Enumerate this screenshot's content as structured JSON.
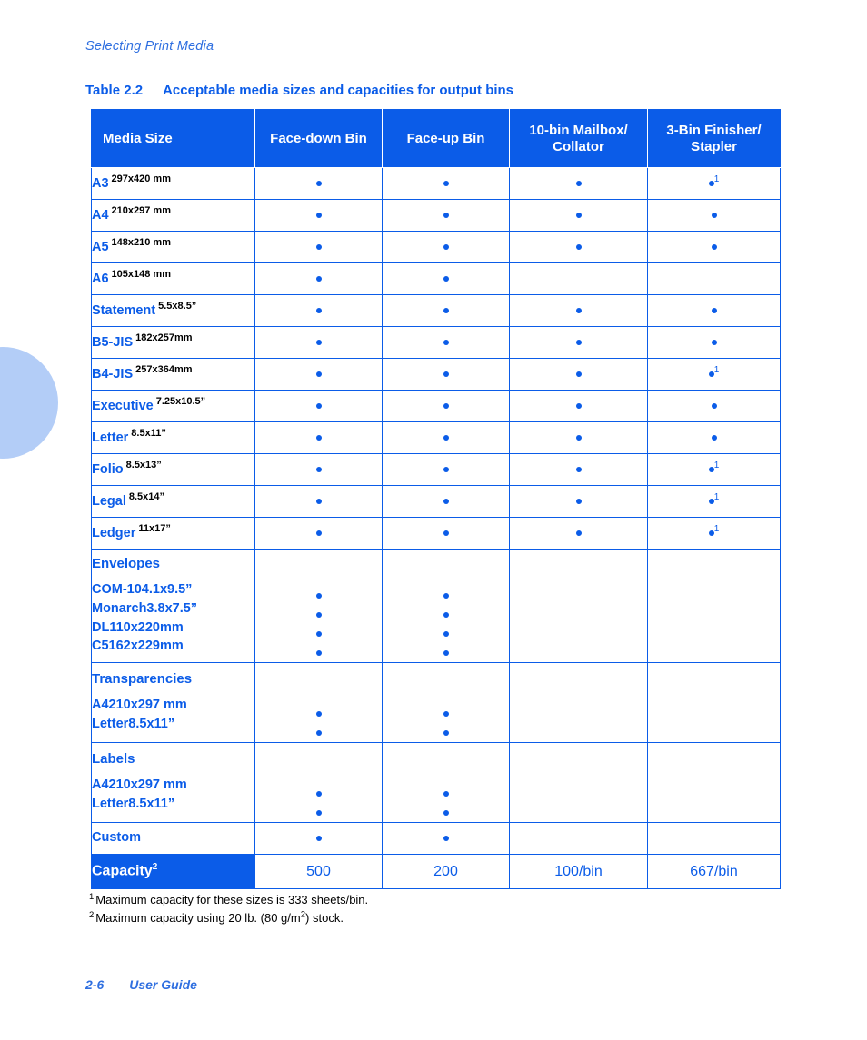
{
  "running_header": "Selecting Print Media",
  "table_caption": {
    "number": "Table 2.2",
    "title": "Acceptable media sizes and capacities for output bins"
  },
  "table": {
    "columns": [
      "Media Size",
      "Face-down Bin",
      "Face-up Bin",
      "10-bin Mailbox/\nCollator",
      "3-Bin Finisher/\nStapler"
    ],
    "column_headers": {
      "media_size": "Media Size",
      "face_down": "Face-down Bin",
      "face_up": "Face-up Bin",
      "mailbox_l1": "10-bin Mailbox/",
      "mailbox_l2": "Collator",
      "finisher_l1": "3-Bin Finisher/",
      "finisher_l2": "Stapler"
    },
    "rows": [
      {
        "name": "A3",
        "dim": "297x420 mm",
        "face_down": true,
        "face_up": true,
        "mailbox": true,
        "finisher": true,
        "finisher_note": "1"
      },
      {
        "name": "A4",
        "dim": "210x297 mm",
        "face_down": true,
        "face_up": true,
        "mailbox": true,
        "finisher": true,
        "finisher_note": ""
      },
      {
        "name": "A5",
        "dim": "148x210 mm",
        "face_down": true,
        "face_up": true,
        "mailbox": true,
        "finisher": true,
        "finisher_note": ""
      },
      {
        "name": "A6",
        "dim": "105x148 mm",
        "face_down": true,
        "face_up": true,
        "mailbox": false,
        "finisher": false,
        "finisher_note": ""
      },
      {
        "name": "Statement",
        "dim": "5.5x8.5”",
        "face_down": true,
        "face_up": true,
        "mailbox": true,
        "finisher": true,
        "finisher_note": ""
      },
      {
        "name": "B5-JIS",
        "dim": "182x257mm",
        "face_down": true,
        "face_up": true,
        "mailbox": true,
        "finisher": true,
        "finisher_note": ""
      },
      {
        "name": "B4-JIS",
        "dim": "257x364mm",
        "face_down": true,
        "face_up": true,
        "mailbox": true,
        "finisher": true,
        "finisher_note": "1"
      },
      {
        "name": "Executive",
        "dim": "7.25x10.5”",
        "face_down": true,
        "face_up": true,
        "mailbox": true,
        "finisher": true,
        "finisher_note": ""
      },
      {
        "name": "Letter",
        "dim": "8.5x11”",
        "face_down": true,
        "face_up": true,
        "mailbox": true,
        "finisher": true,
        "finisher_note": ""
      },
      {
        "name": "Folio",
        "dim": "8.5x13”",
        "face_down": true,
        "face_up": true,
        "mailbox": true,
        "finisher": true,
        "finisher_note": "1"
      },
      {
        "name": "Legal",
        "dim": "8.5x14”",
        "face_down": true,
        "face_up": true,
        "mailbox": true,
        "finisher": true,
        "finisher_note": "1"
      },
      {
        "name": "Ledger",
        "dim": "11x17”",
        "face_down": true,
        "face_up": true,
        "mailbox": true,
        "finisher": true,
        "finisher_note": "1"
      }
    ],
    "groups": [
      {
        "title": "Envelopes",
        "items": [
          {
            "name": "COM-10",
            "dim": "4.1x9.5”",
            "gap": true
          },
          {
            "name": "Monarch",
            "dim": "3.8x7.5”",
            "gap": true
          },
          {
            "name": "DL",
            "dim": "110x220mm",
            "gap": false
          },
          {
            "name": "C5",
            "dim": "162x229mm",
            "gap": false
          }
        ],
        "face_down": [
          true,
          true,
          true,
          true
        ],
        "face_up": [
          true,
          true,
          true,
          true
        ],
        "mailbox": [
          false,
          false,
          false,
          false
        ],
        "finisher": [
          false,
          false,
          false,
          false
        ]
      },
      {
        "title": "Transparencies",
        "items": [
          {
            "name": "A4",
            "dim": "210x297 mm",
            "gap": true
          },
          {
            "name": "Letter",
            "dim": "8.5x11”",
            "gap": true
          }
        ],
        "face_down": [
          true,
          true
        ],
        "face_up": [
          true,
          true
        ],
        "mailbox": [
          false,
          false
        ],
        "finisher": [
          false,
          false
        ]
      },
      {
        "title": "Labels",
        "items": [
          {
            "name": "A4",
            "dim": "210x297 mm",
            "gap": true
          },
          {
            "name": "Letter",
            "dim": "8.5x11”",
            "gap": true
          }
        ],
        "face_down": [
          true,
          true
        ],
        "face_up": [
          true,
          true
        ],
        "mailbox": [
          false,
          false
        ],
        "finisher": [
          false,
          false
        ]
      }
    ],
    "custom_row": {
      "name": "Custom",
      "dim": "",
      "face_down": true,
      "face_up": true,
      "mailbox": false,
      "finisher": false
    },
    "capacity_row": {
      "label": "Capacity",
      "label_note": "2",
      "face_down": "500",
      "face_up": "200",
      "mailbox": "100/bin",
      "finisher": "667/bin"
    }
  },
  "footnotes": [
    {
      "marker": "1",
      "text_before": "Maximum capacity for these sizes is 333 sheets/bin.",
      "text_after": "",
      "sq": ""
    },
    {
      "marker": "2",
      "text_before": "Maximum capacity using 20 lb. (80 g/m",
      "sq": "2",
      "text_after": ") stock."
    }
  ],
  "page_footer": {
    "page_number": "2-6",
    "document_title": "User Guide"
  },
  "colors": {
    "brand_blue": "#0b5ce8",
    "header_italic_blue": "#2f6fe0",
    "circle_blue": "#b3cdf7",
    "text_black": "#000000",
    "page_white": "#ffffff"
  }
}
